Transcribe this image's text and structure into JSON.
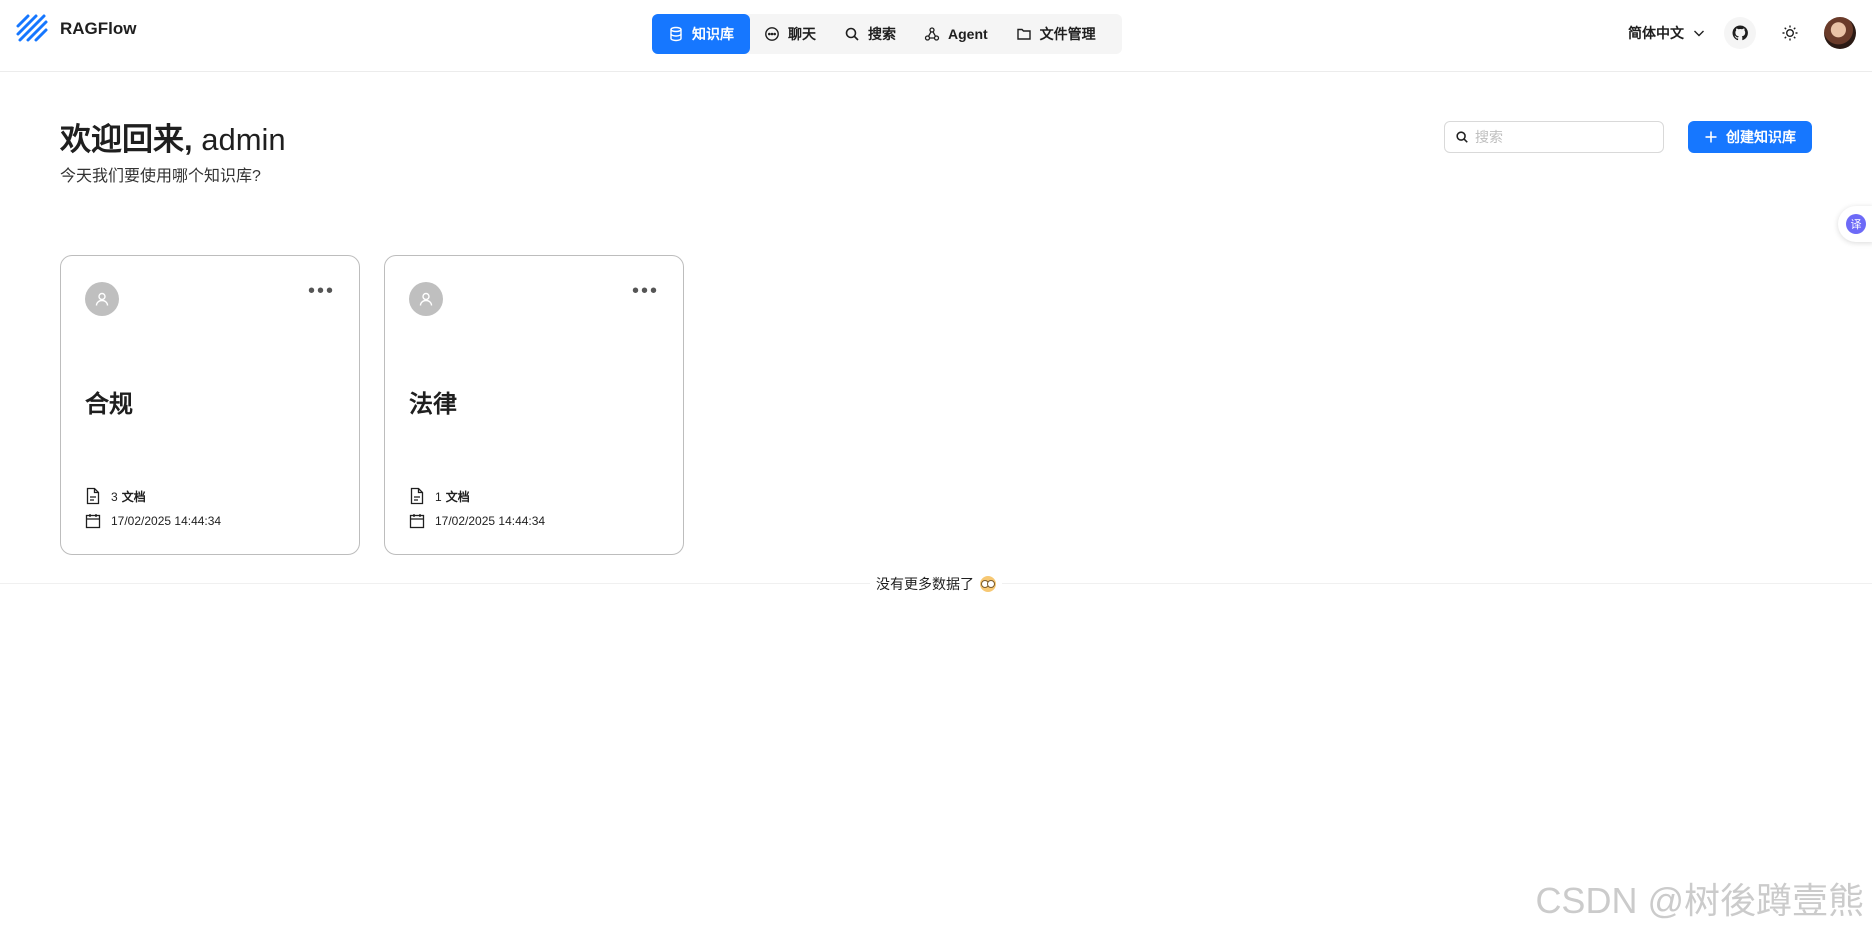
{
  "brand": {
    "name": "RAGFlow"
  },
  "nav": {
    "items": [
      {
        "label": "知识库",
        "icon": "database-icon",
        "active": true
      },
      {
        "label": "聊天",
        "icon": "chat-icon",
        "active": false
      },
      {
        "label": "搜索",
        "icon": "search-icon",
        "active": false
      },
      {
        "label": "Agent",
        "icon": "agent-icon",
        "active": false
      },
      {
        "label": "文件管理",
        "icon": "folder-icon",
        "active": false
      }
    ]
  },
  "header": {
    "language": "简体中文"
  },
  "welcome": {
    "title_prefix": "欢迎回来,",
    "username": " admin",
    "subtitle": "今天我们要使用哪个知识库?"
  },
  "search": {
    "placeholder": "搜索"
  },
  "create_button": {
    "label": "创建知识库"
  },
  "knowledge_bases": [
    {
      "title": "合规",
      "doc_count": "3",
      "doc_label": "文档",
      "updated": "17/02/2025 14:44:34"
    },
    {
      "title": "法律",
      "doc_count": "1",
      "doc_label": "文档",
      "updated": "17/02/2025 14:44:34"
    }
  ],
  "footer": {
    "no_more": "没有更多数据了"
  },
  "floating": {
    "translate_label": "译"
  },
  "watermark": "CSDN @树後蹲壹熊",
  "colors": {
    "primary": "#1677ff",
    "avatar_placeholder": "#bfbfbf"
  }
}
